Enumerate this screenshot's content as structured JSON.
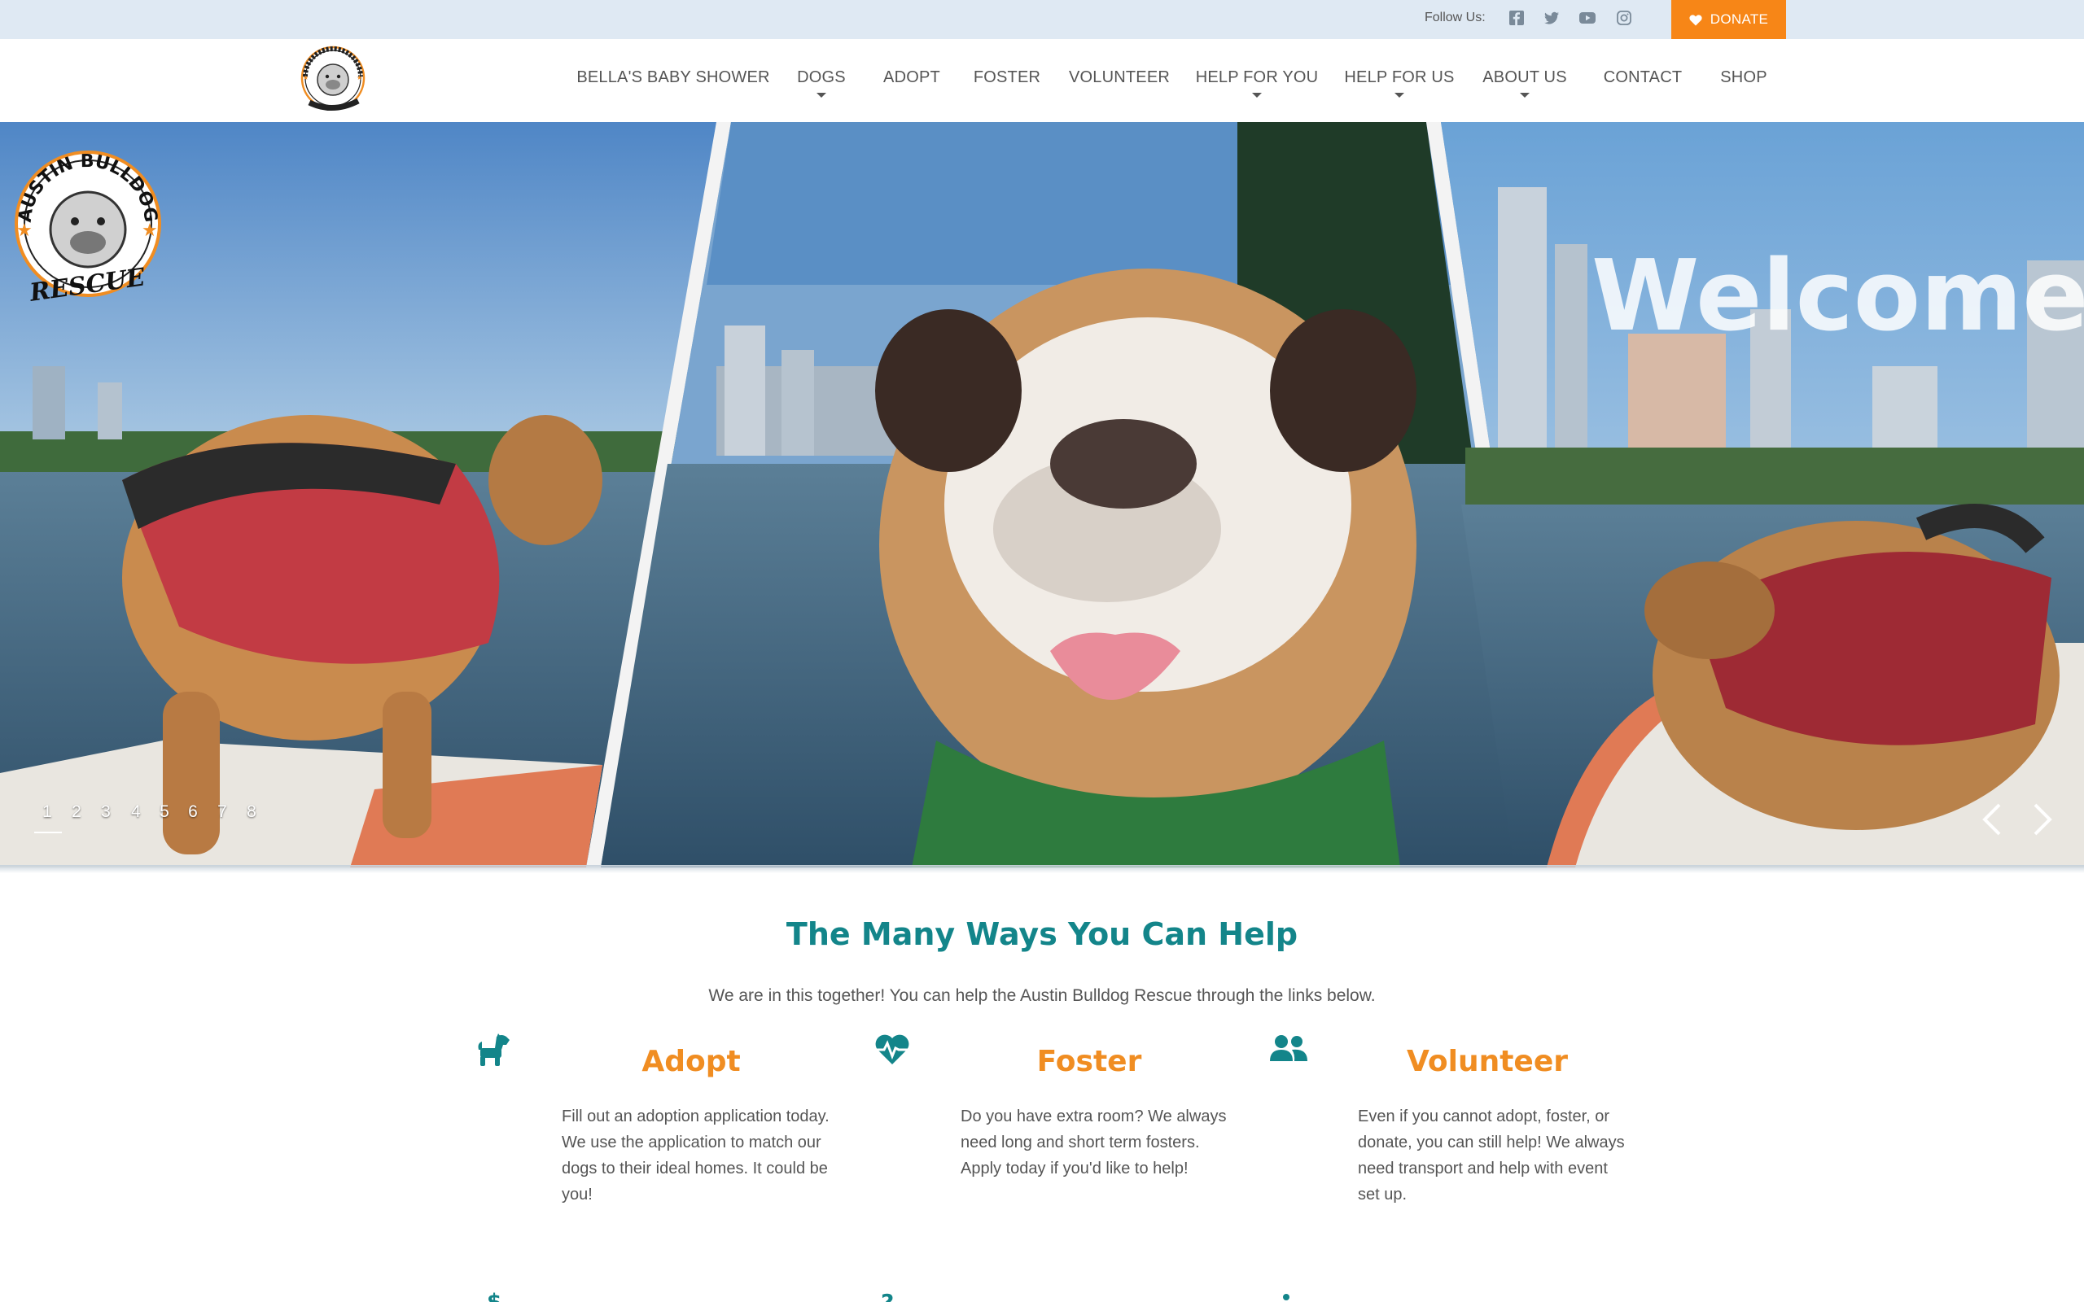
{
  "topbar": {
    "follow_label": "Follow Us:",
    "social": [
      "facebook-icon",
      "twitter-icon",
      "youtube-icon",
      "instagram-icon"
    ],
    "donate_label": "DONATE"
  },
  "nav": {
    "items": [
      {
        "label": "BELLA'S BABY SHOWER",
        "has_dropdown": false
      },
      {
        "label": "DOGS",
        "has_dropdown": true
      },
      {
        "label": "ADOPT",
        "has_dropdown": false
      },
      {
        "label": "FOSTER",
        "has_dropdown": false
      },
      {
        "label": "VOLUNTEER",
        "has_dropdown": false
      },
      {
        "label": "HELP FOR YOU",
        "has_dropdown": true
      },
      {
        "label": "HELP FOR US",
        "has_dropdown": true
      },
      {
        "label": "ABOUT US",
        "has_dropdown": true
      },
      {
        "label": "CONTACT",
        "has_dropdown": false
      },
      {
        "label": "SHOP",
        "has_dropdown": false
      }
    ]
  },
  "logo": {
    "top_text": "AUSTIN BULLDOG",
    "bottom_text": "RESCUE"
  },
  "hero": {
    "welcome": "Welcome",
    "slides": [
      "1",
      "2",
      "3",
      "4",
      "5",
      "6",
      "7",
      "8"
    ],
    "active_slide": "1"
  },
  "help": {
    "title": "The Many Ways You Can Help",
    "intro": "We are in this together! You can help the Austin Bulldog Rescue through the links below.",
    "cards": [
      {
        "icon": "dog-icon",
        "title": "Adopt",
        "text": "Fill out an adoption application today. We use the application to match our dogs to their ideal homes. It could be you!"
      },
      {
        "icon": "heartbeat-icon",
        "title": "Foster",
        "text": "Do you have extra room? We always need long and short term fosters. Apply today if you'd like to help!"
      },
      {
        "icon": "users-icon",
        "title": "Volunteer",
        "text": "Even if you cannot adopt, foster, or donate, you can still help! We always need transport and help with event set up."
      }
    ]
  },
  "colors": {
    "accent_teal": "#13858a",
    "accent_orange": "#f08d22",
    "donate_orange": "#f78617",
    "topbar_bg": "#dfe9f3"
  }
}
